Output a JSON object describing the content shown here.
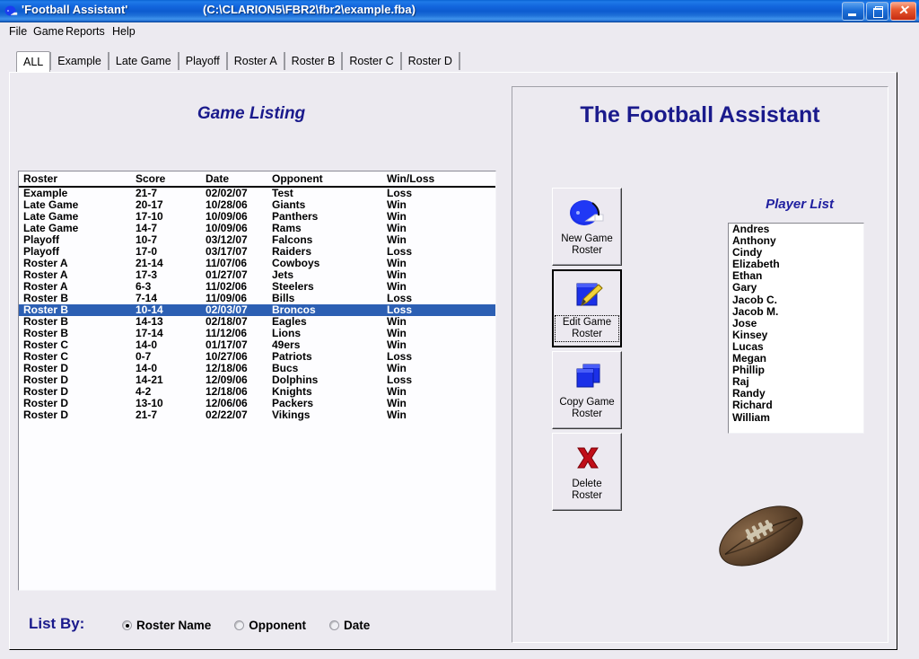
{
  "window": {
    "title": "'Football Assistant'",
    "path": "(C:\\CLARION5\\FBR2\\fbr2\\example.fba)",
    "icon": "football-helmet-icon",
    "buttons": {
      "minimize": "minimize",
      "restore": "restore",
      "close": "close",
      "close_glyph": "✕"
    },
    "accent_title": "#1266dd",
    "close_color": "#c62c12"
  },
  "menubar": {
    "items": [
      "File",
      "Game",
      "Reports",
      "Help"
    ]
  },
  "tabs": {
    "items": [
      "ALL",
      "Example",
      "Late Game",
      "Playoff",
      "Roster A",
      "Roster B",
      "Roster C",
      "Roster D"
    ],
    "active_index": 0
  },
  "game_listing": {
    "title": "Game Listing",
    "columns": [
      "Roster",
      "Score",
      "Date",
      "Opponent",
      "Win/Loss"
    ],
    "selected_index": 10,
    "rows": [
      [
        "Example",
        "21-7",
        "02/02/07",
        "Test",
        "Loss"
      ],
      [
        "Late Game",
        "20-17",
        "10/28/06",
        "Giants",
        "Win"
      ],
      [
        "Late Game",
        "17-10",
        "10/09/06",
        "Panthers",
        "Win"
      ],
      [
        "Late Game",
        "14-7",
        "10/09/06",
        "Rams",
        "Win"
      ],
      [
        "Playoff",
        "10-7",
        "03/12/07",
        "Falcons",
        "Win"
      ],
      [
        "Playoff",
        "17-0",
        "03/17/07",
        "Raiders",
        "Loss"
      ],
      [
        "Roster A",
        "21-14",
        "11/07/06",
        "Cowboys",
        "Win"
      ],
      [
        "Roster A",
        "17-3",
        "01/27/07",
        "Jets",
        "Win"
      ],
      [
        "Roster A",
        "6-3",
        "11/02/06",
        "Steelers",
        "Win"
      ],
      [
        "Roster B",
        "7-14",
        "11/09/06",
        "Bills",
        "Loss"
      ],
      [
        "Roster B",
        "10-14",
        "02/03/07",
        "Broncos",
        "Loss"
      ],
      [
        "Roster B",
        "14-13",
        "02/18/07",
        "Eagles",
        "Win"
      ],
      [
        "Roster B",
        "17-14",
        "11/12/06",
        "Lions",
        "Win"
      ],
      [
        "Roster C",
        "14-0",
        "01/17/07",
        "49ers",
        "Win"
      ],
      [
        "Roster C",
        "0-7",
        "10/27/06",
        "Patriots",
        "Loss"
      ],
      [
        "Roster D",
        "14-0",
        "12/18/06",
        "Bucs",
        "Win"
      ],
      [
        "Roster D",
        "14-21",
        "12/09/06",
        "Dolphins",
        "Loss"
      ],
      [
        "Roster D",
        "4-2",
        "12/18/06",
        "Knights",
        "Win"
      ],
      [
        "Roster D",
        "13-10",
        "12/06/06",
        "Packers",
        "Win"
      ],
      [
        "Roster D",
        "21-7",
        "02/22/07",
        "Vikings",
        "Win"
      ]
    ]
  },
  "list_by": {
    "label": "List By:",
    "options": [
      "Roster Name",
      "Opponent",
      "Date"
    ],
    "selected_index": 0
  },
  "right_panel": {
    "title": "The Football Assistant",
    "buttons": [
      {
        "line1": "New Game",
        "line2": "Roster",
        "icon": "helmet-icon",
        "focused": false
      },
      {
        "line1": "Edit Game",
        "line2": "Roster",
        "icon": "edit-pencil-icon",
        "focused": true
      },
      {
        "line1": "Copy Game",
        "line2": "Roster",
        "icon": "copy-pages-icon",
        "focused": false
      },
      {
        "line1": "Delete",
        "line2": "Roster",
        "icon": "red-x-icon",
        "focused": false
      }
    ],
    "player_list": {
      "title": "Player List",
      "players": [
        "Andres",
        "Anthony",
        "Cindy",
        "Elizabeth",
        "Ethan",
        "Gary",
        "Jacob C.",
        "Jacob M.",
        "Jose",
        "Kinsey",
        "Lucas",
        "Megan",
        "Phillip",
        "Raj",
        "Randy",
        "Richard",
        "William"
      ]
    },
    "decoration": "football-image"
  },
  "colors": {
    "heading_blue": "#1a1a8c",
    "selection_blue": "#2c5fb3",
    "face": "#eceaf0"
  }
}
